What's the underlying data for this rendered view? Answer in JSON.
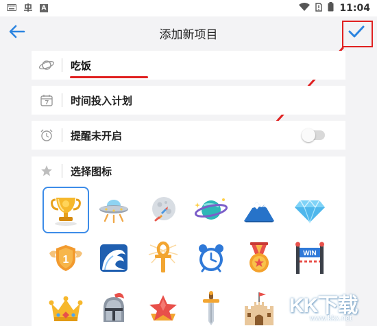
{
  "status_bar": {
    "time": "11:04",
    "left_icons": [
      "keyboard-icon",
      "bug-icon",
      "app-a-icon"
    ],
    "right_icons": [
      "wifi-icon",
      "sim-no-signal-icon",
      "battery-icon"
    ],
    "app_letter": "A"
  },
  "app_bar": {
    "title": "添加新项目",
    "back_icon": "arrow-left-icon",
    "confirm_icon": "checkmark-icon"
  },
  "form": {
    "name": {
      "icon": "planet-outline-icon",
      "value": "吃饭"
    },
    "plan": {
      "icon": "calendar-7-icon",
      "label": "时间投入计划"
    },
    "reminder": {
      "icon": "alarm-clock-icon",
      "label": "提醒未开启",
      "enabled": false
    },
    "icon_picker": {
      "icon": "star-icon",
      "label": "选择图标",
      "selected_index": 0,
      "icons": [
        "trophy-icon",
        "ufo-icon",
        "moon-rocket-icon",
        "saturn-icon",
        "mountain-icon",
        "diamond-icon",
        "winged-medal-1-icon",
        "wave-icon",
        "ankh-icon",
        "alarm-clock-icon",
        "star-medal-icon",
        "win-banner-icon",
        "crown-icon",
        "knight-helmet-icon",
        "star-badge-icon",
        "sword-icon",
        "castle-icon"
      ],
      "medal_text": "1",
      "banner_text": "WIN"
    }
  },
  "accent_color": "#2b84e0",
  "annotation_color": "#e02020",
  "watermark": {
    "main": "KK下载",
    "sub": "www.kkx.net"
  }
}
